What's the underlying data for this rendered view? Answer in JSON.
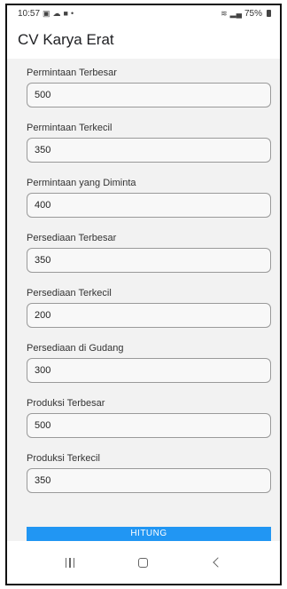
{
  "status_bar": {
    "time": "10:57",
    "right_text": "75%"
  },
  "app_bar": {
    "title": "CV Karya Erat"
  },
  "fields": [
    {
      "label": "Permintaan Terbesar",
      "value": "500"
    },
    {
      "label": "Permintaan Terkecil",
      "value": "350"
    },
    {
      "label": "Permintaan yang Diminta",
      "value": "400"
    },
    {
      "label": "Persediaan Terbesar",
      "value": "350"
    },
    {
      "label": "Persediaan Terkecil",
      "value": "200"
    },
    {
      "label": "Persediaan di Gudang",
      "value": "300"
    },
    {
      "label": "Produksi Terbesar",
      "value": "500"
    },
    {
      "label": "Produksi Terkecil",
      "value": "350"
    }
  ],
  "button": {
    "label": "HITUNG",
    "color": "#2196f3"
  },
  "icons": {
    "status_left": [
      "gallery-icon",
      "cloud-icon",
      "message-icon",
      "dot-icon"
    ],
    "status_right": [
      "wifi-icon",
      "signal-icon",
      "battery-icon"
    ],
    "nav": [
      "recents-icon",
      "home-icon",
      "back-icon"
    ]
  }
}
